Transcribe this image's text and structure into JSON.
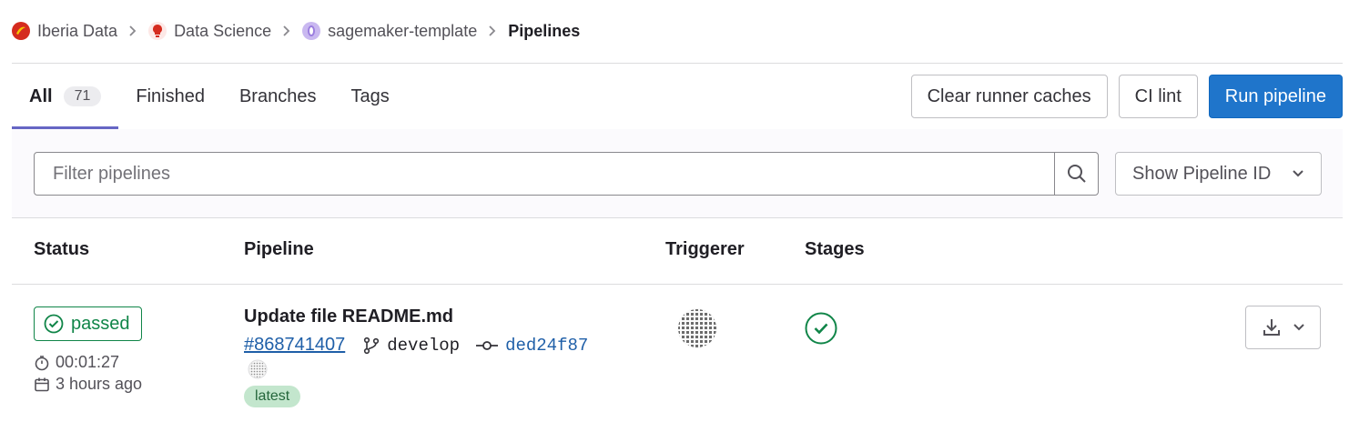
{
  "breadcrumb": {
    "items": [
      {
        "label": "Iberia Data",
        "icon": "iberia-logo-icon",
        "color": "#d52b1e"
      },
      {
        "label": "Data Science",
        "icon": "lightbulb-icon",
        "color": "#d52b1e"
      },
      {
        "label": "sagemaker-template",
        "icon": "project-avatar-icon",
        "color": "#9b7ddf"
      }
    ],
    "current": "Pipelines"
  },
  "tabs": [
    {
      "label": "All",
      "count": "71",
      "active": true
    },
    {
      "label": "Finished"
    },
    {
      "label": "Branches"
    },
    {
      "label": "Tags"
    }
  ],
  "actions": {
    "clear_caches": "Clear runner caches",
    "ci_lint": "CI lint",
    "run_pipeline": "Run pipeline"
  },
  "filter": {
    "placeholder": "Filter pipelines",
    "show_id_select": "Show Pipeline ID"
  },
  "table": {
    "headers": {
      "status": "Status",
      "pipeline": "Pipeline",
      "triggerer": "Triggerer",
      "stages": "Stages"
    },
    "rows": [
      {
        "status": "passed",
        "duration": "00:01:27",
        "finished": "3 hours ago",
        "title": "Update file README.md",
        "pipeline_id": "#868741407",
        "branch": "develop",
        "commit": "ded24f87",
        "tag": "latest"
      }
    ]
  },
  "colors": {
    "primary": "#1f75cb",
    "success": "#108548",
    "tab_indicator": "#6666c4"
  }
}
